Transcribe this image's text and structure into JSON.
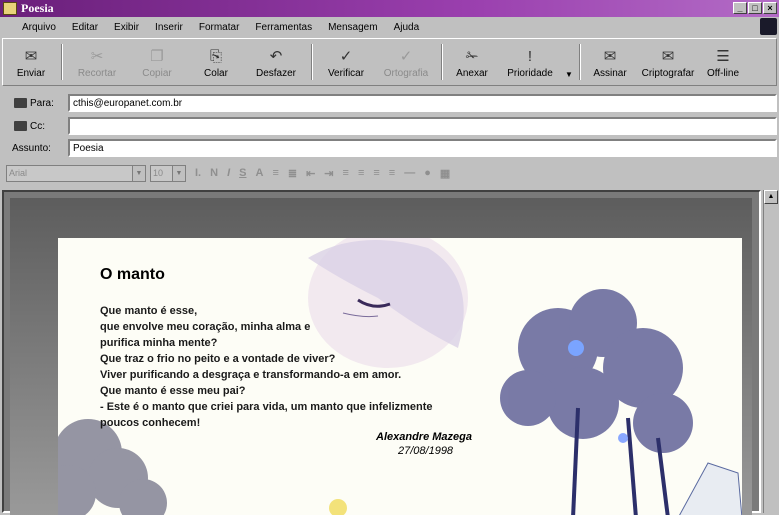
{
  "window": {
    "title": "Poesia",
    "min": "_",
    "max": "□",
    "close": "×"
  },
  "menu": [
    "Arquivo",
    "Editar",
    "Exibir",
    "Inserir",
    "Formatar",
    "Ferramentas",
    "Mensagem",
    "Ajuda"
  ],
  "toolbar": [
    {
      "label": "Enviar",
      "icon": "send-icon",
      "glyph": "✉",
      "enabled": true
    },
    {
      "label": "Recortar",
      "icon": "cut-icon",
      "glyph": "✂",
      "enabled": false
    },
    {
      "label": "Copiar",
      "icon": "copy-icon",
      "glyph": "❐",
      "enabled": false
    },
    {
      "label": "Colar",
      "icon": "paste-icon",
      "glyph": "⎘",
      "enabled": true
    },
    {
      "label": "Desfazer",
      "icon": "undo-icon",
      "glyph": "↶",
      "enabled": true
    },
    {
      "label": "Verificar",
      "icon": "check-names-icon",
      "glyph": "✓",
      "enabled": true
    },
    {
      "label": "Ortografia",
      "icon": "spelling-icon",
      "glyph": "✓",
      "enabled": false
    },
    {
      "label": "Anexar",
      "icon": "attach-icon",
      "glyph": "✁",
      "enabled": true
    },
    {
      "label": "Prioridade",
      "icon": "priority-icon",
      "glyph": "!",
      "enabled": true
    },
    {
      "label": "Assinar",
      "icon": "sign-icon",
      "glyph": "✉",
      "enabled": true
    },
    {
      "label": "Criptografar",
      "icon": "encrypt-icon",
      "glyph": "✉",
      "enabled": true
    },
    {
      "label": "Off-line",
      "icon": "offline-icon",
      "glyph": "☰",
      "enabled": true
    }
  ],
  "fields": {
    "to_label": "Para:",
    "to_value": "cthis@europanet.com.br",
    "cc_label": "Cc:",
    "cc_value": "",
    "subject_label": "Assunto:",
    "subject_value": "Poesia"
  },
  "format": {
    "font": "Arial",
    "size": "10"
  },
  "message": {
    "title": "O manto",
    "lines": [
      "Que manto é esse,",
      "que envolve meu coração, minha alma e",
      "purifica minha mente?",
      "Que traz o frio no peito e a vontade de viver?",
      "Viver purificando a desgraça e transformando-a em amor.",
      "Que manto é esse meu pai?",
      "- Este é o manto que criei para vida, um manto que infelizmente",
      "poucos conhecem!"
    ],
    "signature": "Alexandre Mazega",
    "date": "27/08/1998"
  },
  "colors": {
    "titlebar": "#7a2b8c",
    "chrome": "#c0c0c0"
  }
}
